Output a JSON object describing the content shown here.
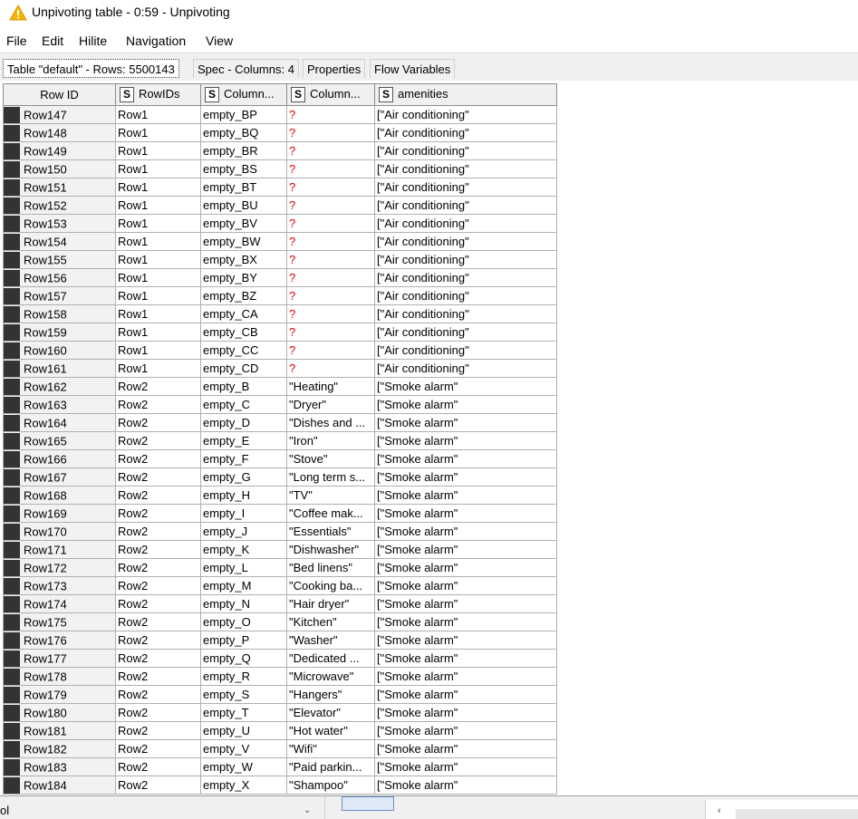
{
  "window": {
    "title": "Unpivoting table - 0:59 - Unpivoting",
    "icon": "warning-triangle-icon",
    "icon_color": "#f5b400"
  },
  "menu": [
    "File",
    "Edit",
    "Hilite",
    "Navigation",
    "View"
  ],
  "tabs": [
    "Table \"default\" - Rows: 5500143",
    "Spec - Columns: 4",
    "Properties",
    "Flow Variables"
  ],
  "table": {
    "columns": [
      {
        "label": "Row ID",
        "type": ""
      },
      {
        "label": "RowIDs",
        "type": "S"
      },
      {
        "label": "Column...",
        "type": "S"
      },
      {
        "label": "Column...",
        "type": "S"
      },
      {
        "label": "amenities",
        "type": "S"
      }
    ],
    "missing_color": "#e00000",
    "rows": [
      [
        "Row147",
        "Row1",
        "empty_BP",
        "?",
        "[\"Air conditioning\""
      ],
      [
        "Row148",
        "Row1",
        "empty_BQ",
        "?",
        "[\"Air conditioning\""
      ],
      [
        "Row149",
        "Row1",
        "empty_BR",
        "?",
        "[\"Air conditioning\""
      ],
      [
        "Row150",
        "Row1",
        "empty_BS",
        "?",
        "[\"Air conditioning\""
      ],
      [
        "Row151",
        "Row1",
        "empty_BT",
        "?",
        "[\"Air conditioning\""
      ],
      [
        "Row152",
        "Row1",
        "empty_BU",
        "?",
        "[\"Air conditioning\""
      ],
      [
        "Row153",
        "Row1",
        "empty_BV",
        "?",
        "[\"Air conditioning\""
      ],
      [
        "Row154",
        "Row1",
        "empty_BW",
        "?",
        "[\"Air conditioning\""
      ],
      [
        "Row155",
        "Row1",
        "empty_BX",
        "?",
        "[\"Air conditioning\""
      ],
      [
        "Row156",
        "Row1",
        "empty_BY",
        "?",
        "[\"Air conditioning\""
      ],
      [
        "Row157",
        "Row1",
        "empty_BZ",
        "?",
        "[\"Air conditioning\""
      ],
      [
        "Row158",
        "Row1",
        "empty_CA",
        "?",
        "[\"Air conditioning\""
      ],
      [
        "Row159",
        "Row1",
        "empty_CB",
        "?",
        "[\"Air conditioning\""
      ],
      [
        "Row160",
        "Row1",
        "empty_CC",
        "?",
        "[\"Air conditioning\""
      ],
      [
        "Row161",
        "Row1",
        "empty_CD",
        "?",
        "[\"Air conditioning\""
      ],
      [
        "Row162",
        "Row2",
        "empty_B",
        "\"Heating\"",
        "[\"Smoke alarm\""
      ],
      [
        "Row163",
        "Row2",
        "empty_C",
        "\"Dryer\"",
        "[\"Smoke alarm\""
      ],
      [
        "Row164",
        "Row2",
        "empty_D",
        "\"Dishes and ...",
        "[\"Smoke alarm\""
      ],
      [
        "Row165",
        "Row2",
        "empty_E",
        "\"Iron\"",
        "[\"Smoke alarm\""
      ],
      [
        "Row166",
        "Row2",
        "empty_F",
        "\"Stove\"",
        "[\"Smoke alarm\""
      ],
      [
        "Row167",
        "Row2",
        "empty_G",
        "\"Long term s...",
        "[\"Smoke alarm\""
      ],
      [
        "Row168",
        "Row2",
        "empty_H",
        "\"TV\"",
        "[\"Smoke alarm\""
      ],
      [
        "Row169",
        "Row2",
        "empty_I",
        "\"Coffee mak...",
        "[\"Smoke alarm\""
      ],
      [
        "Row170",
        "Row2",
        "empty_J",
        "\"Essentials\"",
        "[\"Smoke alarm\""
      ],
      [
        "Row171",
        "Row2",
        "empty_K",
        "\"Dishwasher\"",
        "[\"Smoke alarm\""
      ],
      [
        "Row172",
        "Row2",
        "empty_L",
        "\"Bed linens\"",
        "[\"Smoke alarm\""
      ],
      [
        "Row173",
        "Row2",
        "empty_M",
        "\"Cooking ba...",
        "[\"Smoke alarm\""
      ],
      [
        "Row174",
        "Row2",
        "empty_N",
        "\"Hair dryer\"",
        "[\"Smoke alarm\""
      ],
      [
        "Row175",
        "Row2",
        "empty_O",
        "\"Kitchen\"",
        "[\"Smoke alarm\""
      ],
      [
        "Row176",
        "Row2",
        "empty_P",
        "\"Washer\"",
        "[\"Smoke alarm\""
      ],
      [
        "Row177",
        "Row2",
        "empty_Q",
        "\"Dedicated ...",
        "[\"Smoke alarm\""
      ],
      [
        "Row178",
        "Row2",
        "empty_R",
        "\"Microwave\"",
        "[\"Smoke alarm\""
      ],
      [
        "Row179",
        "Row2",
        "empty_S",
        "\"Hangers\"",
        "[\"Smoke alarm\""
      ],
      [
        "Row180",
        "Row2",
        "empty_T",
        "\"Elevator\"",
        "[\"Smoke alarm\""
      ],
      [
        "Row181",
        "Row2",
        "empty_U",
        "\"Hot water\"",
        "[\"Smoke alarm\""
      ],
      [
        "Row182",
        "Row2",
        "empty_V",
        "\"Wifi\"",
        "[\"Smoke alarm\""
      ],
      [
        "Row183",
        "Row2",
        "empty_W",
        "\"Paid parkin...",
        "[\"Smoke alarm\""
      ],
      [
        "Row184",
        "Row2",
        "empty_X",
        "\"Shampoo\"",
        "[\"Smoke alarm\""
      ]
    ]
  },
  "footer": {
    "left_text": "ol",
    "chevron_icon": "chevron-down-icon",
    "left_arrow_icon": "chevron-left-icon"
  }
}
